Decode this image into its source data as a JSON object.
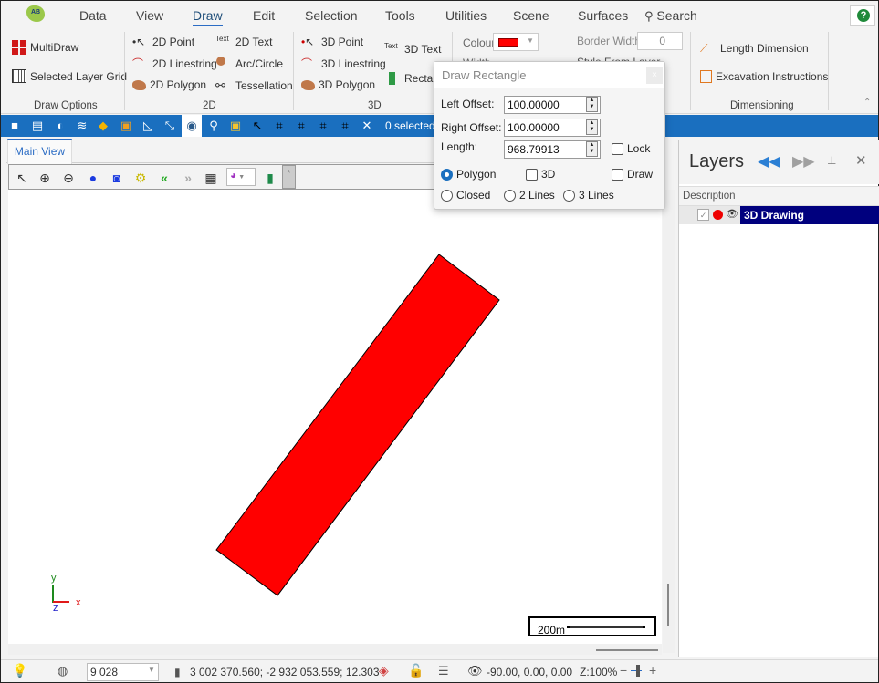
{
  "menu": {
    "items": [
      "Data",
      "View",
      "Draw",
      "Edit",
      "Selection",
      "Tools",
      "Utilities",
      "Scene",
      "Surfaces"
    ],
    "active": "Draw",
    "search_label": "Search",
    "logo_text": "AB",
    "help_icon": "?"
  },
  "ribbon": {
    "draw_options": {
      "label": "Draw Options",
      "multidraw": "MultiDraw",
      "selected_layer_grid": "Selected Layer Grid"
    },
    "group_2d": {
      "label": "2D",
      "point": "2D Point",
      "linestring": "2D Linestring",
      "polygon": "2D Polygon",
      "text": "2D Text",
      "arc_circle": "Arc/Circle",
      "tessellation": "Tessellation"
    },
    "group_3d": {
      "label": "3D",
      "point": "3D Point",
      "linestring": "3D Linestring",
      "polygon": "3D Polygon",
      "text": "3D Text",
      "rectangle": "Rectan"
    },
    "style": {
      "colour_label": "Colour",
      "colour_value": "#ff0000",
      "width_label": "Width",
      "border_width_label": "Border Width",
      "border_width_value": "0",
      "style_from_layer_label": "Style From Layer"
    },
    "dimensioning": {
      "label": "Dimensioning",
      "length_dimension": "Length Dimension",
      "excavation_instructions": "Excavation Instructions"
    }
  },
  "toolbar": {
    "selected_count": "0 selected"
  },
  "tabs": {
    "main_view": "Main View"
  },
  "viewbar": {
    "more": "*"
  },
  "canvas": {
    "shape_color": "#ff0000",
    "scale_bar_label": "200m",
    "axis_labels": {
      "x": "x",
      "y": "y",
      "z": "z"
    }
  },
  "dialog": {
    "title": "Draw Rectangle",
    "close": "×",
    "left_offset_label": "Left Offset:",
    "left_offset_value": "100.00000",
    "right_offset_label": "Right Offset:",
    "right_offset_value": "100.00000",
    "length_label": "Length:",
    "length_value": "968.79913",
    "lock_label": "Lock",
    "lock_checked": false,
    "polygon_label": "Polygon",
    "polygon_selected": true,
    "three_d_label": "3D",
    "three_d_checked": false,
    "draw_label": "Draw",
    "draw_checked": false,
    "closed_label": "Closed",
    "two_lines_label": "2 Lines",
    "three_lines_label": "3 Lines"
  },
  "layers": {
    "title": "Layers",
    "column_header": "Description",
    "rows": [
      {
        "name": "3D Drawing",
        "visible": true,
        "color": "#ee0000"
      }
    ]
  },
  "statusbar": {
    "scale_value": "9 028",
    "coordinates": "3 002 370.560; -2 932 053.559; 12.303",
    "view_angles": "-90.00, 0.00, 0.00",
    "zoom": "Z:100%",
    "zoom_minus": "−",
    "zoom_plus": "+"
  }
}
